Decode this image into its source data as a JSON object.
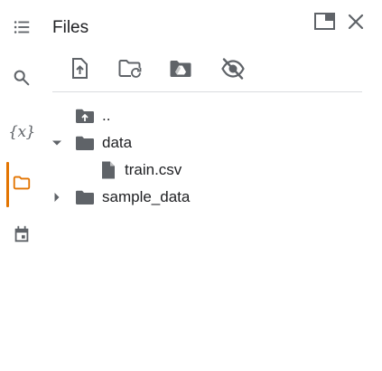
{
  "panel": {
    "title": "Files"
  },
  "rail": {
    "items": [
      {
        "icon": "list-icon"
      },
      {
        "icon": "search-icon"
      },
      {
        "icon": "variables-icon",
        "glyph": "{x}"
      },
      {
        "icon": "folder-icon",
        "active": true
      },
      {
        "icon": "calendar-icon"
      }
    ],
    "active_color": "#e37400"
  },
  "toolbar": {
    "buttons": [
      {
        "icon": "upload-file-icon"
      },
      {
        "icon": "refresh-folder-icon"
      },
      {
        "icon": "mount-drive-icon"
      },
      {
        "icon": "hide-files-icon"
      }
    ]
  },
  "tree": {
    "items": [
      {
        "label": "..",
        "icon": "folder-up-icon",
        "expanded": null
      },
      {
        "label": "data",
        "icon": "folder-icon",
        "expanded": true
      },
      {
        "label": "train.csv",
        "icon": "file-icon",
        "expanded": null
      },
      {
        "label": "sample_data",
        "icon": "folder-icon",
        "expanded": false
      }
    ]
  },
  "colors": {
    "icon": "#5f6368",
    "text": "#202124",
    "divider": "#dadce0"
  }
}
